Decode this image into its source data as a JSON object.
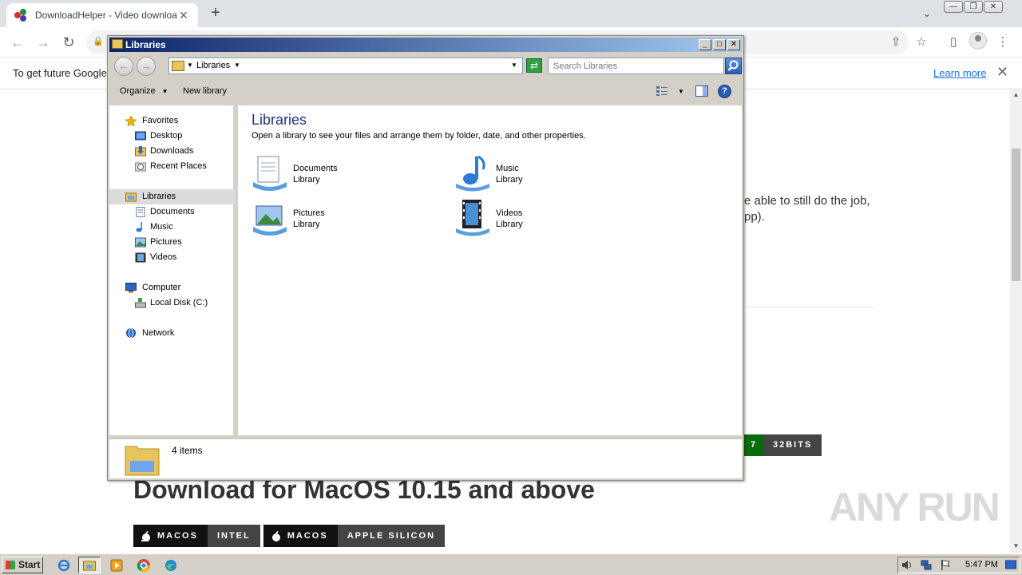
{
  "browser": {
    "tab_title": "DownloadHelper - Video download br",
    "tab_close": "✕",
    "new_tab": "+",
    "tab_search": "⌄",
    "back": "←",
    "forward": "→",
    "reload": "↻",
    "lock": "🔒",
    "share": "⇪",
    "star": "☆",
    "sidepanel": "▯",
    "menu": "⋮",
    "window_min": "—",
    "window_restore": "❐",
    "window_close": "✕"
  },
  "infobar": {
    "text": "To get future Google",
    "learn_more": "Learn more",
    "close": "✕"
  },
  "page": {
    "fragment_line1": "e able to still do the job,",
    "fragment_line2": "pp).",
    "win_badge_num": "7",
    "win_badge_arch": "32BITS",
    "mac_heading": "Download for MacOS 10.15 and above",
    "mac_buttons": [
      {
        "os": "MACOS",
        "arch": "INTEL"
      },
      {
        "os": "MACOS",
        "arch": "APPLE SILICON"
      }
    ],
    "watermark": "ANY RUN"
  },
  "explorer": {
    "title": "Libraries",
    "minimize": "_",
    "maximize": "□",
    "close": "✕",
    "back": "←",
    "forward": "→",
    "address": "Libraries",
    "search_placeholder": "Search Libraries",
    "commands": {
      "organize": "Organize",
      "new_library": "New library"
    },
    "nav": {
      "favorites": "Favorites",
      "desktop": "Desktop",
      "downloads": "Downloads",
      "recent": "Recent Places",
      "libraries": "Libraries",
      "documents": "Documents",
      "music": "Music",
      "pictures": "Pictures",
      "videos": "Videos",
      "computer": "Computer",
      "local_disk": "Local Disk (C:)",
      "network": "Network"
    },
    "heading": "Libraries",
    "subheading": "Open a library to see your files and arrange them by folder, date, and other properties.",
    "libraries": [
      {
        "name": "Documents",
        "type": "Library"
      },
      {
        "name": "Music",
        "type": "Library"
      },
      {
        "name": "Pictures",
        "type": "Library"
      },
      {
        "name": "Videos",
        "type": "Library"
      }
    ],
    "status": "4 items"
  },
  "taskbar": {
    "start": "Start",
    "clock": "5:47 PM"
  },
  "colors": {
    "titlebar_start": "#0a246a",
    "titlebar_end": "#a6caf0",
    "link": "#1a73e8",
    "heading_blue": "#1e3287",
    "win_badge_green": "#0b6a0b"
  }
}
